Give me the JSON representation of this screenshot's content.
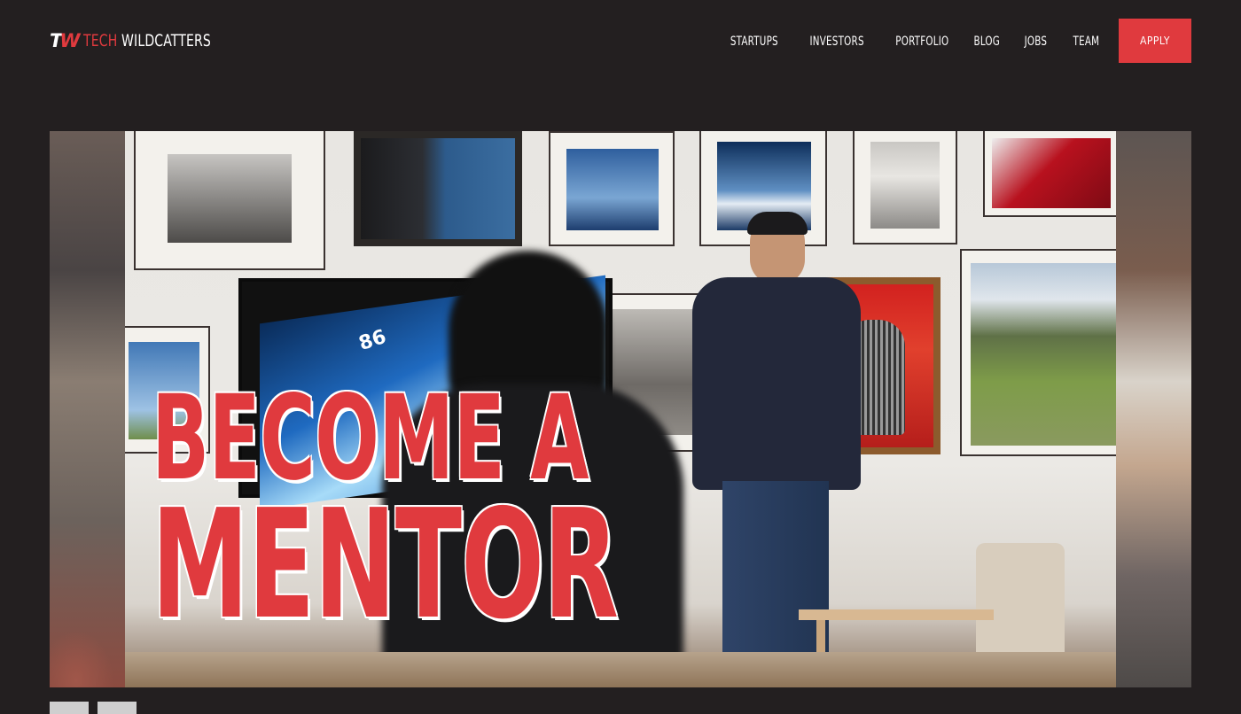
{
  "header": {
    "logo": {
      "mark_t": "T",
      "mark_w": "W",
      "tech": "TECH",
      "name": "WILDCATTERS"
    },
    "nav": [
      {
        "label": "STARTUPS"
      },
      {
        "label": "INVESTORS"
      },
      {
        "label": "PORTFOLIO"
      },
      {
        "label": "BLOG"
      },
      {
        "label": "JOBS"
      },
      {
        "label": "TEAM"
      }
    ],
    "apply_label": "APPLY"
  },
  "carousel": {
    "headline_line1": "BECOME A",
    "headline_line2": "MENTOR",
    "screen_number": "86"
  },
  "colors": {
    "background": "#231f20",
    "accent": "#e03a3e",
    "text": "#ffffff"
  }
}
